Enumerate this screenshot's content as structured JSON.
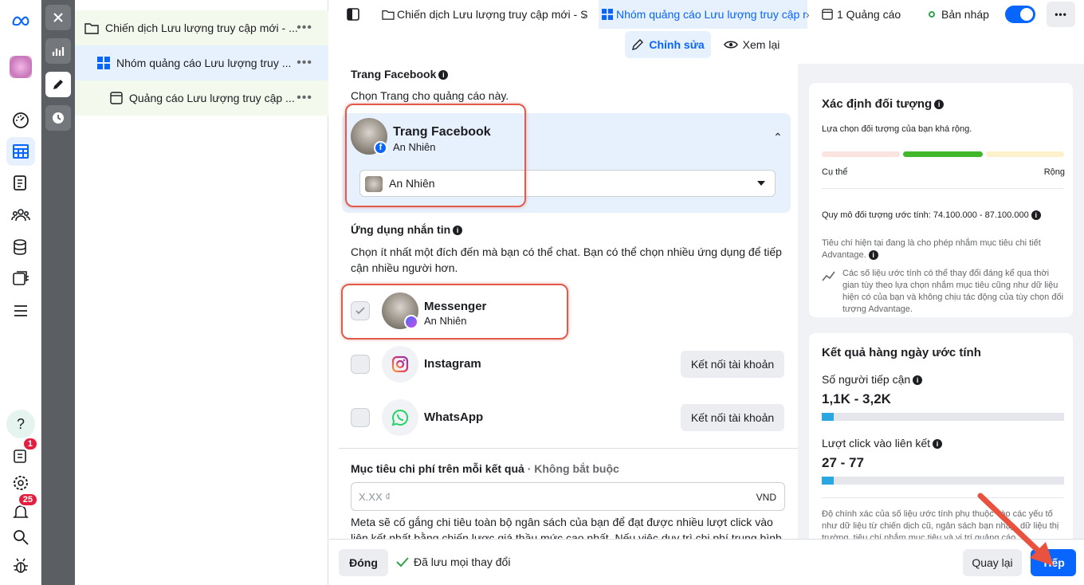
{
  "colors": {
    "accent": "#0866ff",
    "highlight_red": "#e25b4a"
  },
  "rail": {
    "icons": [
      "meta-logo-icon",
      "avatar",
      "dashboard-icon",
      "table-icon",
      "pages-icon",
      "audience-icon",
      "billing-icon",
      "catalog-icon",
      "menu-icon",
      "help-icon",
      "notifications-icon",
      "settings-icon",
      "alerts-icon",
      "search-icon",
      "bug-icon"
    ],
    "badge_notifications": "1",
    "badge_alerts": "25"
  },
  "tree": {
    "campaign": "Chiến dịch Lưu lượng truy cập mới - ...",
    "adset": "Nhóm quảng cáo Lưu lượng truy ...",
    "ad": "Quảng cáo Lưu lượng truy cập ...",
    "more": "•••"
  },
  "topbar": {
    "crumb_campaign": "Chiến dịch Lưu lượng truy cập mới - S",
    "crumb_adset": "Nhóm quảng cáo Lưu lượng truy cập r",
    "crumb_ads": "1 Quảng cáo",
    "status": "Bản nháp",
    "edit": "Chỉnh sửa",
    "review": "Xem lại",
    "more": "•••"
  },
  "main": {
    "page_section_title": "Trang Facebook",
    "page_section_desc": "Chọn Trang cho quảng cáo này.",
    "page_card_title": "Trang Facebook",
    "page_card_name": "An Nhiên",
    "page_select_value": "An Nhiên",
    "messaging_title": "Ứng dụng nhắn tin",
    "messaging_desc": "Chọn ít nhất một đích đến mà bạn có thể chat. Bạn có thể chọn nhiều ứng dụng để tiếp cận nhiều người hơn.",
    "apps": [
      {
        "name": "Messenger",
        "sub": "An Nhiên",
        "checked": true
      },
      {
        "name": "Instagram",
        "button": "Kết nối tài khoản",
        "checked": false
      },
      {
        "name": "WhatsApp",
        "button": "Kết nối tài khoản",
        "checked": false
      }
    ],
    "cost_title": "Mục tiêu chi phí trên mỗi kết quả",
    "cost_optional": "· Không bắt buộc",
    "cost_placeholder": "X.XX ₫",
    "cost_currency": "VND",
    "cost_desc": "Meta sẽ cố gắng chi tiêu toàn bộ ngân sách của bạn để đạt được nhiều lượt click vào liên kết nhất bằng chiến lược giá thầu mức cao nhất. Nếu việc duy trì chi phí trung bình trên mỗi"
  },
  "side": {
    "audience_title": "Xác định đối tượng",
    "audience_desc": "Lựa chọn đối tượng của bạn khá rộng.",
    "gauge_left": "Cụ thể",
    "gauge_right": "Rộng",
    "audience_size": "Quy mô đối tượng ước tính: 74.100.000 - 87.100.000",
    "advantage_note": "Tiêu chí hiện tại đang là cho phép nhắm mục tiêu chi tiết Advantage.",
    "estimate_note": "Các số liệu ước tính có thể thay đổi đáng kể qua thời gian tùy theo lựa chọn nhắm mục tiêu cũng như dữ liệu hiện có của bạn và không chịu tác động của tùy chọn đối tượng Advantage.",
    "daily_title": "Kết quả hàng ngày ước tính",
    "reach_label": "Số người tiếp cận",
    "reach_value": "1,1K - 3,2K",
    "reach_fraction": 0.05,
    "clicks_label": "Lượt click vào liên kết",
    "clicks_value": "27 - 77",
    "clicks_fraction": 0.05,
    "accuracy_note": "Độ chính xác của số liệu ước tính phụ thuộc vào các yếu tố như dữ liệu từ chiến dịch cũ, ngân sách bạn nhập, dữ liệu thị trường, tiêu chí nhắm mục tiêu và vị trí quảng cáo."
  },
  "bottom": {
    "close": "Đóng",
    "saved": "Đã lưu mọi thay đổi",
    "back": "Quay lại",
    "next": "Tiếp"
  }
}
